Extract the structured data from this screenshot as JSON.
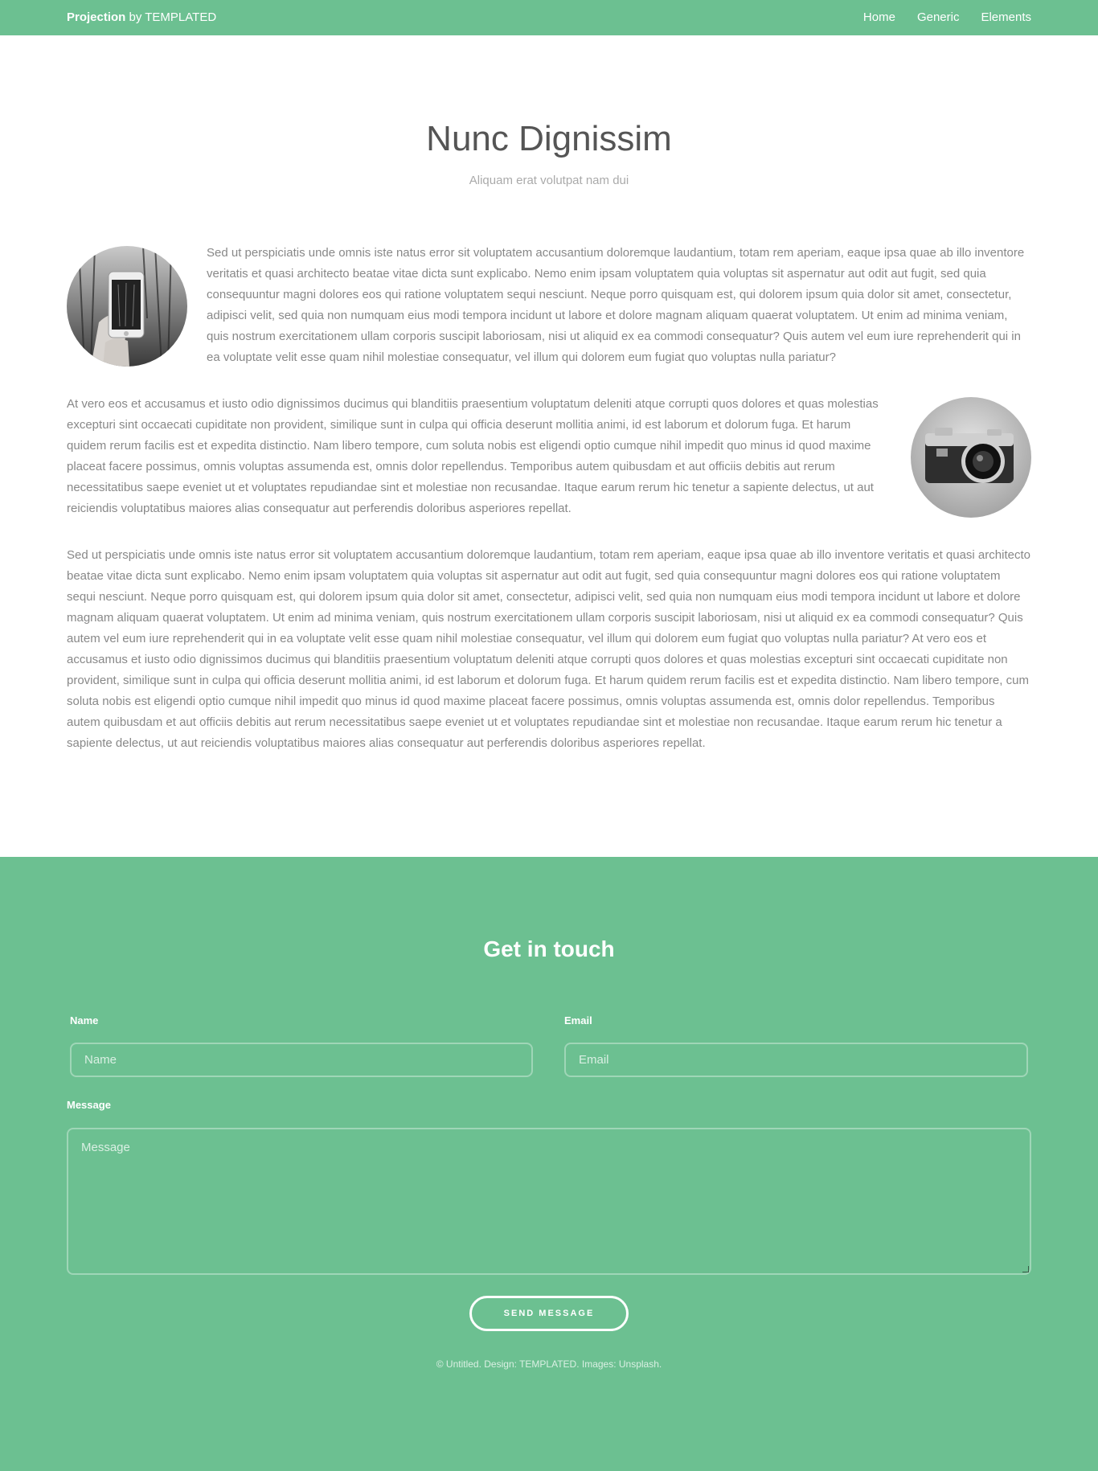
{
  "header": {
    "logo_strong": "Projection",
    "logo_rest": " by TEMPLATED",
    "nav": [
      {
        "label": "Home"
      },
      {
        "label": "Generic"
      },
      {
        "label": "Elements"
      }
    ]
  },
  "main": {
    "title": "Nunc Dignissim",
    "subtitle": "Aliquam erat volutpat nam dui",
    "paragraphs": [
      "Sed ut perspiciatis unde omnis iste natus error sit voluptatem accusantium doloremque laudantium, totam rem aperiam, eaque ipsa quae ab illo inventore veritatis et quasi architecto beatae vitae dicta sunt explicabo. Nemo enim ipsam voluptatem quia voluptas sit aspernatur aut odit aut fugit, sed quia consequuntur magni dolores eos qui ratione voluptatem sequi nesciunt. Neque porro quisquam est, qui dolorem ipsum quia dolor sit amet, consectetur, adipisci velit, sed quia non numquam eius modi tempora incidunt ut labore et dolore magnam aliquam quaerat voluptatem. Ut enim ad minima veniam, quis nostrum exercitationem ullam corporis suscipit laboriosam, nisi ut aliquid ex ea commodi consequatur? Quis autem vel eum iure reprehenderit qui in ea voluptate velit esse quam nihil molestiae consequatur, vel illum qui dolorem eum fugiat quo voluptas nulla pariatur?",
      "At vero eos et accusamus et iusto odio dignissimos ducimus qui blanditiis praesentium voluptatum deleniti atque corrupti quos dolores et quas molestias excepturi sint occaecati cupiditate non provident, similique sunt in culpa qui officia deserunt mollitia animi, id est laborum et dolorum fuga. Et harum quidem rerum facilis est et expedita distinctio. Nam libero tempore, cum soluta nobis est eligendi optio cumque nihil impedit quo minus id quod maxime placeat facere possimus, omnis voluptas assumenda est, omnis dolor repellendus. Temporibus autem quibusdam et aut officiis debitis aut rerum necessitatibus saepe eveniet ut et voluptates repudiandae sint et molestiae non recusandae. Itaque earum rerum hic tenetur a sapiente delectus, ut aut reiciendis voluptatibus maiores alias consequatur aut perferendis doloribus asperiores repellat.",
      "Sed ut perspiciatis unde omnis iste natus error sit voluptatem accusantium doloremque laudantium, totam rem aperiam, eaque ipsa quae ab illo inventore veritatis et quasi architecto beatae vitae dicta sunt explicabo. Nemo enim ipsam voluptatem quia voluptas sit aspernatur aut odit aut fugit, sed quia consequuntur magni dolores eos qui ratione voluptatem sequi nesciunt. Neque porro quisquam est, qui dolorem ipsum quia dolor sit amet, consectetur, adipisci velit, sed quia non numquam eius modi tempora incidunt ut labore et dolore magnam aliquam quaerat voluptatem. Ut enim ad minima veniam, quis nostrum exercitationem ullam corporis suscipit laboriosam, nisi ut aliquid ex ea commodi consequatur? Quis autem vel eum iure reprehenderit qui in ea voluptate velit esse quam nihil molestiae consequatur, vel illum qui dolorem eum fugiat quo voluptas nulla pariatur? At vero eos et accusamus et iusto odio dignissimos ducimus qui blanditiis praesentium voluptatum deleniti atque corrupti quos dolores et quas molestias excepturi sint occaecati cupiditate non provident, similique sunt in culpa qui officia deserunt mollitia animi, id est laborum et dolorum fuga. Et harum quidem rerum facilis est et expedita distinctio. Nam libero tempore, cum soluta nobis est eligendi optio cumque nihil impedit quo minus id quod maxime placeat facere possimus, omnis voluptas assumenda est, omnis dolor repellendus. Temporibus autem quibusdam et aut officiis debitis aut rerum necessitatibus saepe eveniet ut et voluptates repudiandae sint et molestiae non recusandae. Itaque earum rerum hic tenetur a sapiente delectus, ut aut reiciendis voluptatibus maiores alias consequatur aut perferendis doloribus asperiores repellat."
    ],
    "images": [
      {
        "icon": "phone-photo-image"
      },
      {
        "icon": "camera-photo-image"
      }
    ]
  },
  "footer": {
    "title": "Get in touch",
    "name_label": "Name",
    "name_placeholder": "Name",
    "email_label": "Email",
    "email_placeholder": "Email",
    "message_label": "Message",
    "message_placeholder": "Message",
    "send_label": "SEND MESSAGE",
    "copyright": "© Untitled. Design: TEMPLATED. Images: Unsplash."
  },
  "colors": {
    "accent": "#6cc091",
    "heading": "#555555",
    "body_text": "#888888"
  }
}
